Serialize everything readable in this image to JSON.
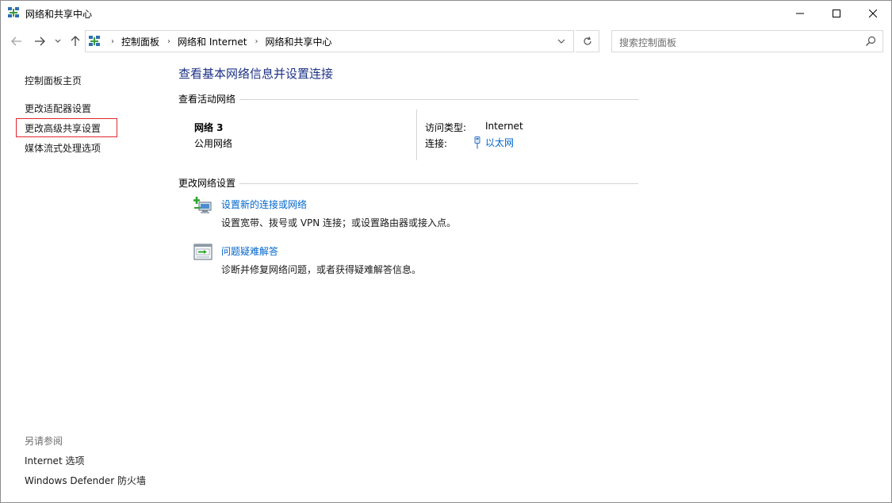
{
  "window": {
    "title": "网络和共享中心",
    "icon": "network-icon"
  },
  "address": {
    "crumbs": [
      "控制面板",
      "网络和 Internet",
      "网络和共享中心"
    ]
  },
  "search": {
    "placeholder": "搜索控制面板"
  },
  "sidebar": {
    "home": "控制面板主页",
    "items": [
      {
        "label": "更改适配器设置"
      },
      {
        "label": "更改高级共享设置",
        "highlighted": true
      },
      {
        "label": "媒体流式处理选项"
      }
    ],
    "see_also_title": "另请参阅",
    "see_also": [
      {
        "label": "Internet 选项"
      },
      {
        "label": "Windows Defender 防火墙"
      }
    ]
  },
  "main": {
    "title": "查看基本网络信息并设置连接",
    "active_networks_heading": "查看活动网络",
    "network": {
      "name": "网络 3",
      "type": "公用网络",
      "access_type_label": "访问类型:",
      "access_type_value": "Internet",
      "connection_label": "连接:",
      "connection_value": "以太网"
    },
    "change_settings_heading": "更改网络设置",
    "tasks": [
      {
        "icon": "new-connection-icon",
        "link": "设置新的连接或网络",
        "desc": "设置宽带、拨号或 VPN 连接；或设置路由器或接入点。"
      },
      {
        "icon": "troubleshoot-icon",
        "link": "问题疑难解答",
        "desc": "诊断并修复网络问题，或者获得疑难解答信息。"
      }
    ]
  },
  "colors": {
    "title_blue": "#1e3287",
    "link_blue": "#0066cc",
    "highlight_red": "#e0282f"
  }
}
